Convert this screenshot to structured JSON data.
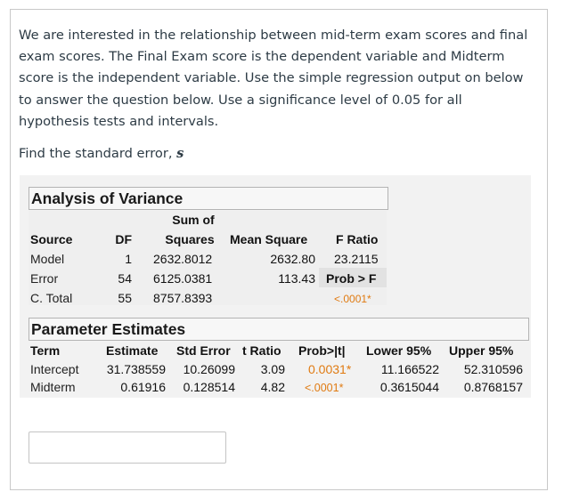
{
  "prompt": "We are interested in the relationship between mid-term exam scores and final exam scores.  The Final Exam score is the dependent variable and Midterm score is the independent variable. Use the simple regression output on below to answer the question below. Use a significance level of 0.05 for all hypothesis tests and intervals.",
  "question": {
    "text": "Find the standard error, ",
    "symbol": "s"
  },
  "anova": {
    "title": "Analysis of Variance",
    "header_top": "Sum of",
    "headers": {
      "source": "Source",
      "df": "DF",
      "ss": "Squares",
      "ms": "Mean Square",
      "f": "F Ratio"
    },
    "rows": [
      {
        "source": "Model",
        "df": "1",
        "ss": "2632.8012",
        "ms": "2632.80",
        "f": "23.2115"
      },
      {
        "source": "Error",
        "df": "54",
        "ss": "6125.0381",
        "ms": "113.43",
        "f": "Prob > F"
      },
      {
        "source": "C. Total",
        "df": "55",
        "ss": "8757.8393",
        "ms": "",
        "f": "<.0001*"
      }
    ]
  },
  "parameter_estimates": {
    "title": "Parameter Estimates",
    "headers": {
      "term": "Term",
      "estimate": "Estimate",
      "std_error": "Std Error",
      "t_ratio": "t Ratio",
      "prob": "Prob>|t|",
      "lower": "Lower 95%",
      "upper": "Upper 95%"
    },
    "rows": [
      {
        "term": "Intercept",
        "estimate": "31.738559",
        "std_error": "10.26099",
        "t_ratio": "3.09",
        "prob": "0.0031*",
        "lower": "11.166522",
        "upper": "52.310596"
      },
      {
        "term": "Midterm",
        "estimate": "0.61916",
        "std_error": "0.128514",
        "t_ratio": "4.82",
        "prob": "<.0001*",
        "lower": "0.3615044",
        "upper": "0.8768157"
      }
    ]
  },
  "answer": {
    "value": ""
  },
  "colors": {
    "significance": "#e07b12",
    "text": "#2d3b45"
  }
}
